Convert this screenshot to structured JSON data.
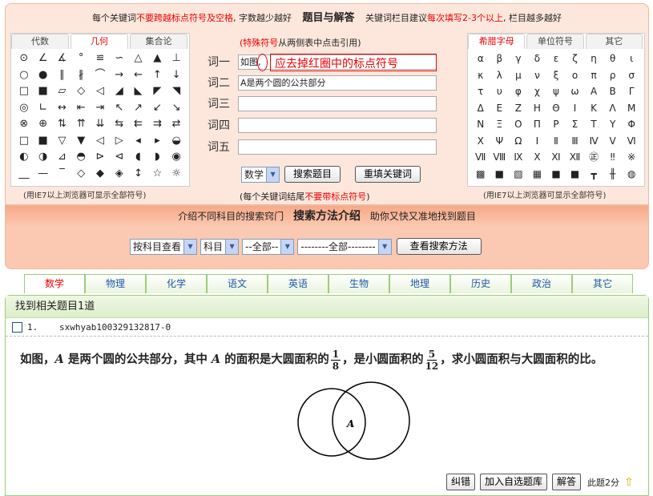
{
  "top_hint": {
    "prefix": "每个关键词",
    "warn": "不要跨越标点符号及空格",
    "mid": ", 字数越少越好",
    "title": "题目与解答",
    "kw_prefix": "关键词栏目建议",
    "kw_warn": "每次填写2-3个以上",
    "kw_suffix": ", 栏目越多越好"
  },
  "left_panel": {
    "tabs": [
      "代数",
      "几何",
      "集合论"
    ],
    "active_tab": 1,
    "symbols": [
      "⊙",
      "∠",
      "∡",
      "°",
      "≌",
      "∽",
      "△",
      "▲",
      "⊥",
      "○",
      "●",
      "∥",
      "∦",
      "⌒",
      "→",
      "←",
      "↑",
      "↓",
      "□",
      "■",
      "▱",
      "◇",
      "◁",
      "◢",
      "◣",
      "◤",
      "◥",
      "◎",
      "∟",
      "↔",
      "⇤",
      "⇥",
      "↖",
      "↗",
      "↙",
      "↘",
      "⊗",
      "⊕",
      "⇅",
      "⇈",
      "⇊",
      "⇆",
      "⇇",
      "⇉",
      "⇄",
      "□",
      "■",
      "▽",
      "▼",
      "◁",
      "▷",
      "◂",
      "▸",
      "◒",
      "◐",
      "◑",
      "⊿",
      "◓",
      "⊳",
      "⊲",
      "◖",
      "◗",
      "◉",
      "__",
      "—",
      "‾",
      "◇",
      "◆",
      "◈",
      "↕",
      "☆",
      "☼"
    ],
    "note": "(用IE7以上浏览器可显示全部符号)"
  },
  "right_panel": {
    "tabs": [
      "希腊字母",
      "单位符号",
      "其它"
    ],
    "active_tab": 0,
    "symbols": [
      "α",
      "β",
      "γ",
      "δ",
      "ε",
      "ζ",
      "η",
      "θ",
      "ι",
      "κ",
      "λ",
      "μ",
      "ν",
      "ξ",
      "ο",
      "π",
      "ρ",
      "σ",
      "τ",
      "υ",
      "φ",
      "χ",
      "ψ",
      "ω",
      "Α",
      "Β",
      "Γ",
      "Δ",
      "Ε",
      "Ζ",
      "Η",
      "Θ",
      "Ι",
      "Κ",
      "Λ",
      "Μ",
      "Ν",
      "Ξ",
      "Ο",
      "Π",
      "Ρ",
      "Σ",
      "Τ",
      "Υ",
      "Φ",
      "Χ",
      "Ψ",
      "Ω",
      "Ⅰ",
      "Ⅱ",
      "Ⅲ",
      "Ⅳ",
      "Ⅴ",
      "Ⅵ",
      "Ⅶ",
      "Ⅷ",
      "Ⅸ",
      "Ⅹ",
      "Ⅺ",
      "Ⅻ",
      "㊣",
      "‼",
      "※",
      "▩",
      "■",
      "▧",
      "▦",
      "■",
      "■",
      "┳",
      "╫",
      "◍"
    ],
    "note": "(用IE7以上浏览器可显示全部符号)"
  },
  "center": {
    "hint_red": "(特殊符号",
    "hint_rest": "从两侧表中点击引用)",
    "keywords": [
      {
        "label": "词一",
        "value": "如图,"
      },
      {
        "label": "词二",
        "value": "A是两个圆的公共部分"
      },
      {
        "label": "词三",
        "value": ""
      },
      {
        "label": "词四",
        "value": ""
      },
      {
        "label": "词五",
        "value": ""
      }
    ],
    "annotation": "应去掉红圈中的标点符号",
    "subject_select": "数学",
    "search_button": "搜索题目",
    "reset_button": "重填关键词",
    "note_prefix": "(每个关键词结尾",
    "note_red": "不要带标点符号",
    "note_suffix": ")"
  },
  "method": {
    "left": "介绍不同科目的搜索窍门",
    "title": "搜索方法介绍",
    "right": "助你又快又准地找到题目",
    "select1": "按科目查看",
    "select2": "科目",
    "select3": "--全部--",
    "select4": "--------全部--------",
    "button": "查看搜索方法"
  },
  "subjects": [
    "数学",
    "物理",
    "化学",
    "语文",
    "英语",
    "生物",
    "地理",
    "历史",
    "政治",
    "其它"
  ],
  "active_subject": 0,
  "results": {
    "header": "找到相关题目1道",
    "item_number": "1.",
    "item_id": "sxwhyab100329132817-0",
    "question_p1": "如图，",
    "question_A1": "A",
    "question_p2": " 是两个圆的公共部分，其中 ",
    "question_A2": "A",
    "question_p3": " 的面积是大圆面积的",
    "frac1_num": "1",
    "frac1_den": "8",
    "question_p4": "，是小圆面积的",
    "frac2_num": "5",
    "frac2_den": "12",
    "question_p5": "，求小圆面积与大圆面积的比。",
    "figure_label": "A",
    "btn_correct": "纠错",
    "btn_add": "加入自选题库",
    "btn_answer": "解答",
    "score": "此题2分"
  }
}
